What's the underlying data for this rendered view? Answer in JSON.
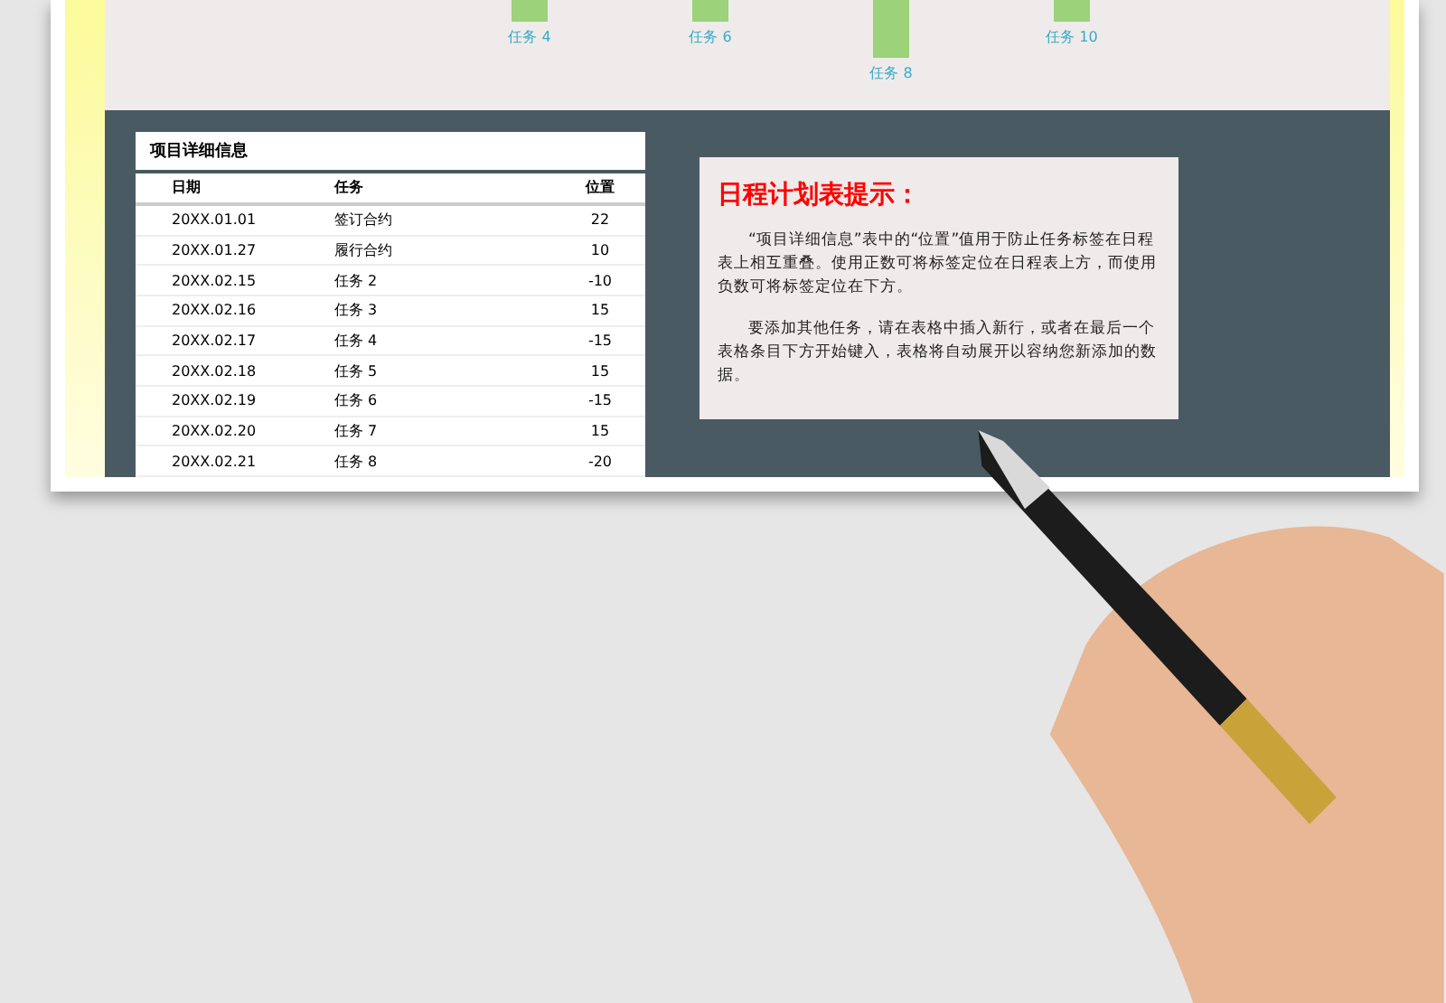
{
  "chart": {
    "labels": [
      {
        "text": "任务 4",
        "kind": "near"
      },
      {
        "text": "任务 6",
        "kind": "near"
      },
      {
        "text": "任务 8",
        "kind": "far"
      },
      {
        "text": "任务 10",
        "kind": "near"
      }
    ]
  },
  "table": {
    "title": "项目详细信息",
    "columns": [
      "日期",
      "任务",
      "位置"
    ],
    "rows": [
      [
        "20XX.01.01",
        "签订合约",
        "22"
      ],
      [
        "20XX.01.27",
        "履行合约",
        "10"
      ],
      [
        "20XX.02.15",
        "任务 2",
        "-10"
      ],
      [
        "20XX.02.16",
        "任务 3",
        "15"
      ],
      [
        "20XX.02.17",
        "任务 4",
        "-15"
      ],
      [
        "20XX.02.18",
        "任务 5",
        "15"
      ],
      [
        "20XX.02.19",
        "任务 6",
        "-15"
      ],
      [
        "20XX.02.20",
        "任务 7",
        "15"
      ],
      [
        "20XX.02.21",
        "任务 8",
        "-20"
      ]
    ]
  },
  "tip": {
    "title": "日程计划表提示：",
    "paragraphs": [
      "“项目详细信息”表中的“位置”值用于防止任务标签在日程表上相互重叠。使用正数可将标签定位在日程表上方，而使用负数可将标签定位在下方。",
      "要添加其他任务，请在表格中插入新行，或者在最后一个表格条目下方开始键入，表格将自动展开以容纳您新添加的数据。"
    ]
  }
}
